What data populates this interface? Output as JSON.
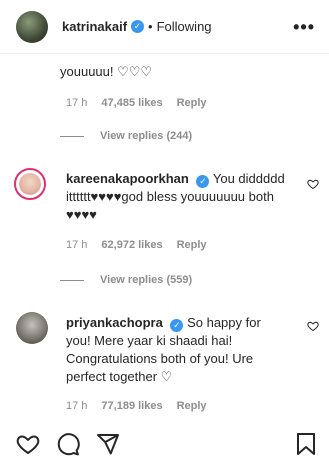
{
  "header": {
    "username": "katrinakaif",
    "separator": "•",
    "follow_status": "Following",
    "more": "•••"
  },
  "comments": [
    {
      "text_tail": "youuuuu! ♡♡♡",
      "time": "17 h",
      "likes": "47,485 likes",
      "reply": "Reply",
      "view_replies": "View replies (244)"
    },
    {
      "username": "kareenakapoorkhan",
      "line1": "You diddddd",
      "line2": "itttttt♥♥♥♥god bless youuuuuuu both",
      "line3": "♥♥♥♥",
      "time": "17 h",
      "likes": "62,972 likes",
      "reply": "Reply",
      "view_replies": "View replies (559)"
    },
    {
      "username": "priyankachopra",
      "line1": "So happy for",
      "line2": "you! Mere yaar ki shaadi hai!",
      "line3": "Congratulations both of you! Ure",
      "line4": "perfect together ♡",
      "time": "17 h",
      "likes": "77,189 likes",
      "reply": "Reply"
    }
  ],
  "colors": {
    "verified": "#3897f0",
    "secondary_text": "#8e8e8e",
    "primary_text": "#262626"
  },
  "icons": [
    "heart-icon",
    "comment-icon",
    "share-icon",
    "bookmark-icon",
    "verified-badge-icon"
  ]
}
